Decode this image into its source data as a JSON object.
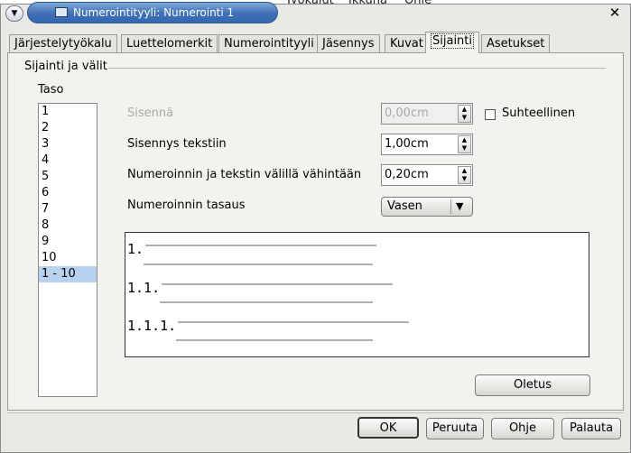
{
  "background_menu": [
    "Työkalut",
    "Ikkuna",
    "Ohje"
  ],
  "window": {
    "title": "Numerointityyli: Numerointi 1"
  },
  "tabs": [
    {
      "label": "Järjestelytyökalu"
    },
    {
      "label": "Luettelomerkit"
    },
    {
      "label": "Numerointityyli"
    },
    {
      "label": "Jäsennys"
    },
    {
      "label": "Kuvat"
    },
    {
      "label": "Sijainti"
    },
    {
      "label": "Asetukset"
    }
  ],
  "active_tab": "Sijainti",
  "group_title": "Sijainti ja välit",
  "level": {
    "label": "Taso",
    "items": [
      "1",
      "2",
      "3",
      "4",
      "5",
      "6",
      "7",
      "8",
      "9",
      "10",
      "1 - 10"
    ],
    "selected": "1 - 10"
  },
  "fields": {
    "indent": {
      "label": "Sisennä",
      "value": "0,00cm",
      "disabled": true
    },
    "relative": {
      "label": "Suhteellinen",
      "checked": false
    },
    "text_indent": {
      "label": "Sisennys tekstiin",
      "value": "1,00cm"
    },
    "min_spacing": {
      "label": "Numeroinnin ja tekstin välillä vähintään",
      "value": "0,20cm"
    },
    "alignment": {
      "label": "Numeroinnin tasaus",
      "value": "Vasen"
    }
  },
  "preview": [
    "1.",
    "1.1.",
    "1.1.1."
  ],
  "buttons": {
    "default": "Oletus",
    "ok": "OK",
    "cancel": "Peruuta",
    "help": "Ohje",
    "reset": "Palauta"
  }
}
